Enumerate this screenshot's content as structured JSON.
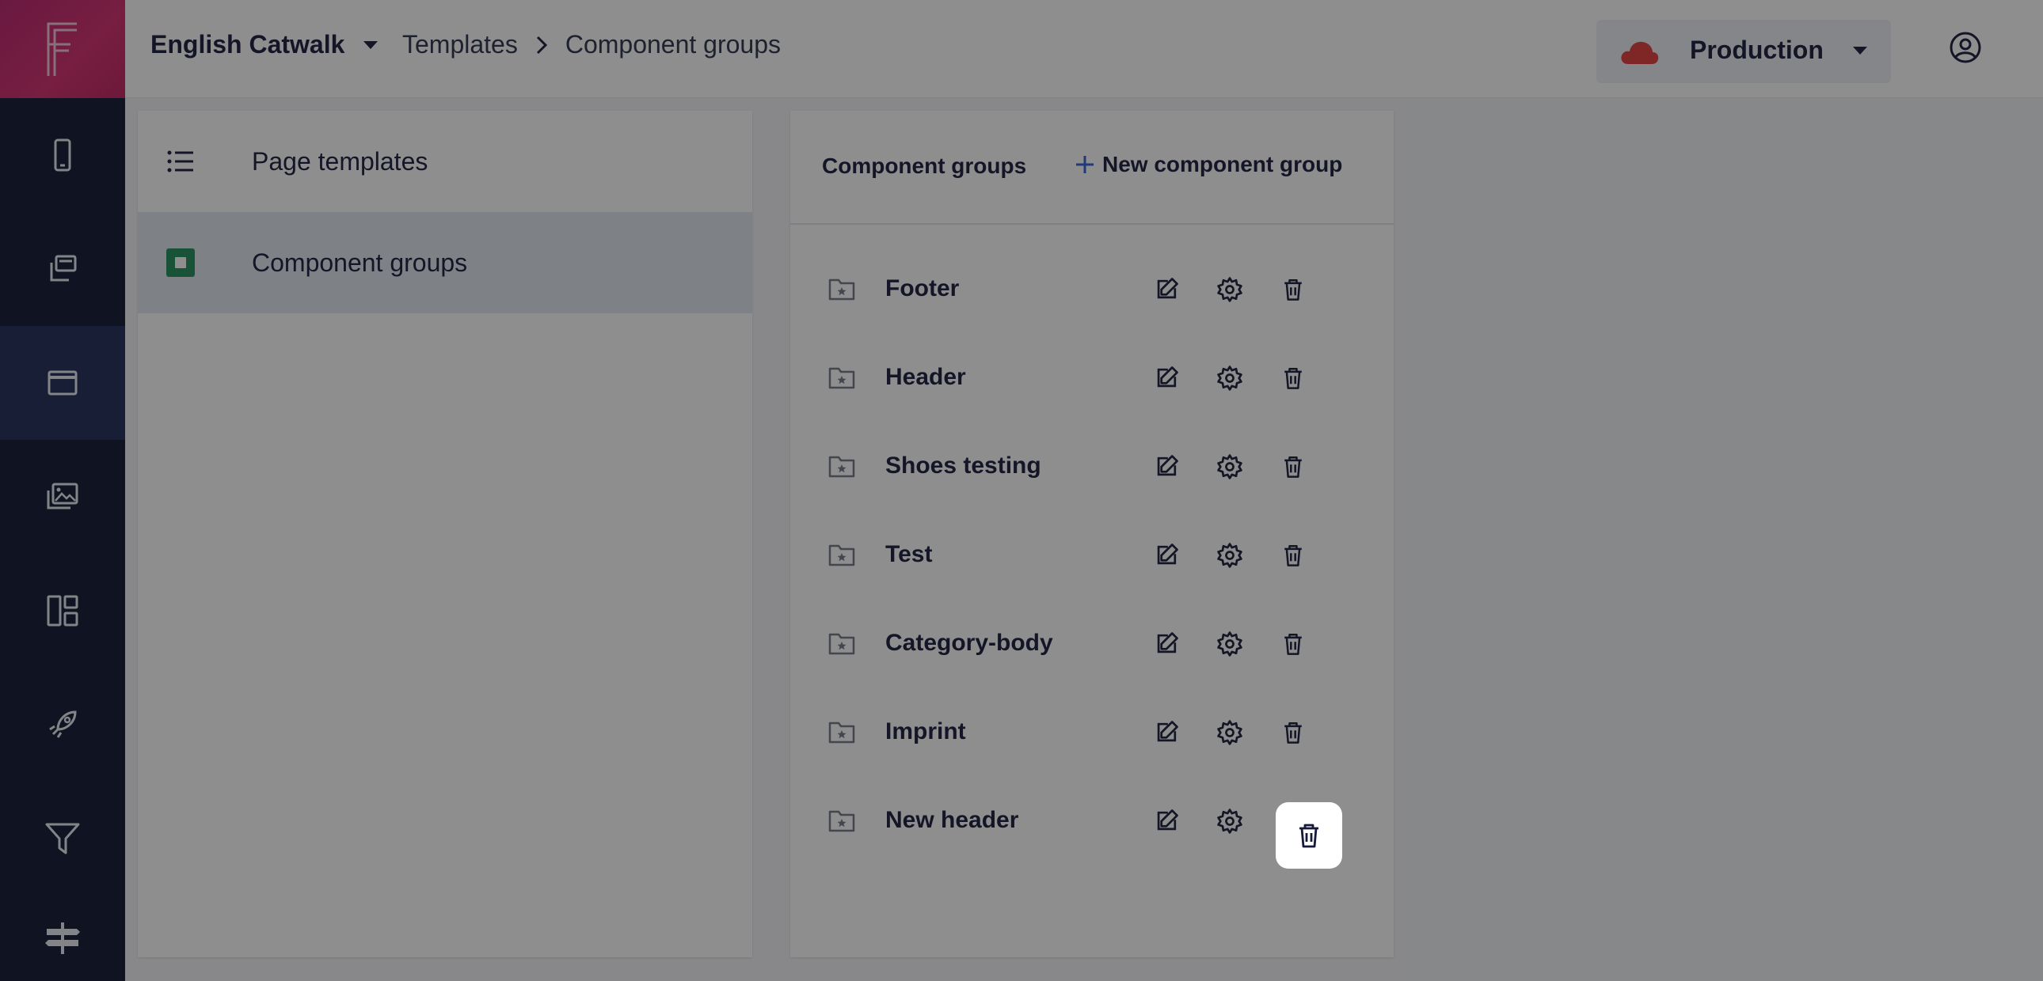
{
  "app": {
    "project": "English Catwalk",
    "breadcrumb": [
      "Templates",
      "Component groups"
    ],
    "environment": "Production",
    "accent_color": "#d42a6c",
    "environment_icon_color": "#e23b3b"
  },
  "rail": {
    "items": [
      {
        "icon": "mobile-icon"
      },
      {
        "icon": "copy-icon"
      },
      {
        "icon": "window-icon",
        "active": true
      },
      {
        "icon": "images-icon"
      },
      {
        "icon": "layout-icon"
      },
      {
        "icon": "rocket-icon"
      },
      {
        "icon": "filter-icon"
      },
      {
        "icon": "signpost-icon"
      }
    ]
  },
  "templates_nav": {
    "items": [
      {
        "label": "Page templates",
        "icon": "list-icon"
      },
      {
        "label": "Component groups",
        "icon": "component-icon",
        "selected": true
      }
    ]
  },
  "component_groups": {
    "title": "Component groups",
    "new_label": "New component group",
    "rows": [
      {
        "name": "Footer"
      },
      {
        "name": "Header"
      },
      {
        "name": "Shoes testing"
      },
      {
        "name": "Test"
      },
      {
        "name": "Category-body"
      },
      {
        "name": "Imprint"
      },
      {
        "name": "New header"
      }
    ],
    "highlighted_action": "delete"
  }
}
